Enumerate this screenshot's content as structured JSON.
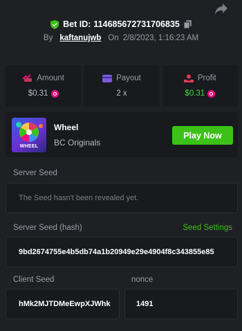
{
  "header": {
    "bet_id_label": "Bet ID:",
    "bet_id": "114685672731706835",
    "by_label": "By",
    "username": "kaftanujwb",
    "on_label": "On",
    "datetime": "2/8/2023, 1:16:23 AM"
  },
  "stats": [
    {
      "label": "Amount",
      "value": "$0.31",
      "icon": "amount-icon"
    },
    {
      "label": "Payout",
      "value": "2 x",
      "icon": "payout-icon"
    },
    {
      "label": "Profit",
      "value": "$0.31",
      "icon": "profit-icon"
    }
  ],
  "game": {
    "name": "Wheel",
    "provider": "BC Originals",
    "thumb_text": "WHEEL",
    "play_label": "Play Now"
  },
  "server_seed": {
    "label": "Server Seed",
    "value": "The Seed hasn't been revealed yet."
  },
  "server_seed_hash": {
    "label": "Server Seed (hash)",
    "settings_label": "Seed Settings",
    "value": "9bd2674755e4b5db74a1b20949e29e4904f8c343855e85"
  },
  "client_seed": {
    "label": "Client Seed",
    "value": "hMk2MJTDMeEwpXJWhk"
  },
  "nonce": {
    "label": "nonce",
    "value": "1491"
  },
  "colors": {
    "background": "#1e2024",
    "panel": "#181a1e",
    "accent_green": "#3bc117",
    "profit_green": "#3fdc3f",
    "coin_pink": "#e9117c",
    "shield_green": "#3bc117"
  }
}
